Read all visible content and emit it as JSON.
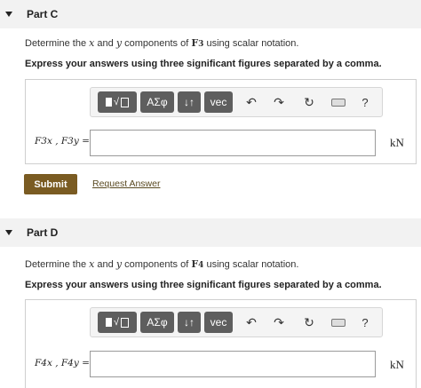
{
  "parts": [
    {
      "title": "Part C",
      "prompt": {
        "t1": "Determine the ",
        "x": "x",
        "t2": " and ",
        "y": "y",
        "t3": " components of ",
        "force": "F",
        "force_sub": "3",
        "t4": " using scalar notation."
      },
      "instruction": "Express your answers using three significant figures separated by a comma.",
      "variable_label": "F3x , F3y =",
      "field_value": "",
      "unit": "kN"
    },
    {
      "title": "Part D",
      "prompt": {
        "t1": "Determine the ",
        "x": "x",
        "t2": " and ",
        "y": "y",
        "t3": " components of ",
        "force": "F",
        "force_sub": "4",
        "t4": " using scalar notation."
      },
      "instruction": "Express your answers using three significant figures separated by a comma.",
      "variable_label": "F4x , F4y =",
      "field_value": "",
      "unit": "kN"
    }
  ],
  "toolbar": {
    "templates_icon": "templates-icon",
    "greek_label": "ΑΣφ",
    "arrows_label": "↓↑",
    "vec_label": "vec",
    "undo_icon": "undo-icon",
    "redo_icon": "redo-icon",
    "reset_icon": "reset-icon",
    "keyboard_icon": "keyboard-icon",
    "help_label": "?"
  },
  "actions": {
    "submit_label": "Submit",
    "request_label": "Request Answer"
  },
  "colors": {
    "submit_bg": "#7a5b22",
    "toolbar_btn": "#5e5e5e",
    "header_bg": "#f2f2f2"
  }
}
